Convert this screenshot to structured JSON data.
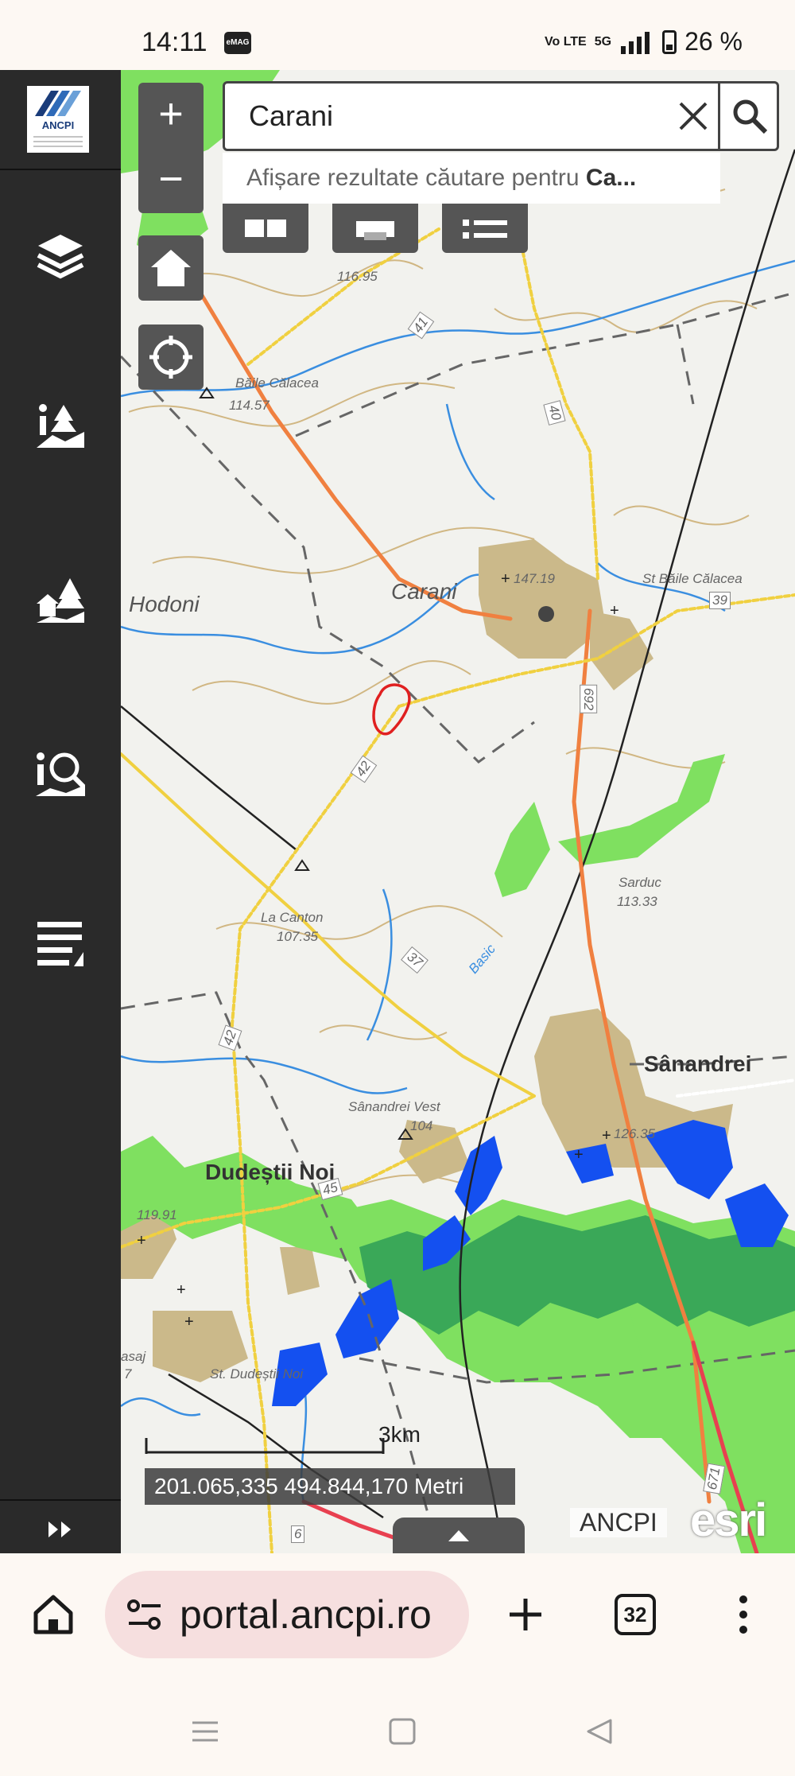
{
  "status_bar": {
    "time": "14:11",
    "app_badge": "eMAG",
    "network_label": "Vo LTE",
    "signal_label": "5G",
    "battery_percent": "26 %"
  },
  "sidebar": {
    "logo_text": "ANCPI",
    "items": [
      {
        "icon": "layers-icon"
      },
      {
        "icon": "info-land-icon"
      },
      {
        "icon": "buildings-icon"
      },
      {
        "icon": "info-search-icon"
      },
      {
        "icon": "list-icon"
      }
    ],
    "collapse_icon": "double-chevron-right-icon"
  },
  "map": {
    "search": {
      "value": "Carani",
      "suggestion_prefix": "Afișare rezultate căutare pentru ",
      "suggestion_term": "Ca..."
    },
    "places": [
      {
        "id": "carani",
        "label": "Carani"
      },
      {
        "id": "hodoni",
        "label": "Hodoni"
      },
      {
        "id": "baile-calacea",
        "label": "Băile Călacea"
      },
      {
        "id": "baile-calacea-elev",
        "label": "114.57"
      },
      {
        "id": "top-elev",
        "label": "116.95"
      },
      {
        "id": "carani-elev",
        "label": "147.19"
      },
      {
        "id": "st-baile-calacea",
        "label": "St Băile Călacea"
      },
      {
        "id": "la-canton",
        "label": "La Canton"
      },
      {
        "id": "la-canton-elev",
        "label": "107.35"
      },
      {
        "id": "sanandrei",
        "label": "Sânandrei"
      },
      {
        "id": "sanandrei-elev",
        "label": "126.35"
      },
      {
        "id": "sanandrei-vest",
        "label": "Sânandrei Vest"
      },
      {
        "id": "sanandrei-vest-elev",
        "label": "104"
      },
      {
        "id": "dudestii-noi",
        "label": "Dudeștii Noi"
      },
      {
        "id": "dudestii-elev",
        "label": "119.91"
      },
      {
        "id": "st-dudestii-noi",
        "label": "St. Dudeștii Noi"
      },
      {
        "id": "sarduc-elev",
        "label": "113.33"
      },
      {
        "id": "sarduc",
        "label": "Sarduc"
      },
      {
        "id": "basic",
        "label": "Basic"
      },
      {
        "id": "asaj",
        "label": "asaj"
      },
      {
        "id": "asaj-num",
        "label": "7"
      }
    ],
    "road_labels": [
      "41",
      "40",
      "39",
      "692",
      "42",
      "37",
      "42",
      "45",
      "6",
      "671"
    ],
    "scale_label": "3km",
    "coordinates": "201.065,335 494.844,170 Metri",
    "attribution": "ANCPI",
    "basemap_logo": "esri",
    "colors": {
      "forest_light": "#7fe060",
      "forest_dark": "#3aa858",
      "water": "#1450f0",
      "settlement": "#cbb98a",
      "road_orange": "#f08040",
      "road_yellow": "#f0d040",
      "marker": "#e02020"
    }
  },
  "browser": {
    "url": "portal.ancpi.ro",
    "tab_count": "32"
  }
}
